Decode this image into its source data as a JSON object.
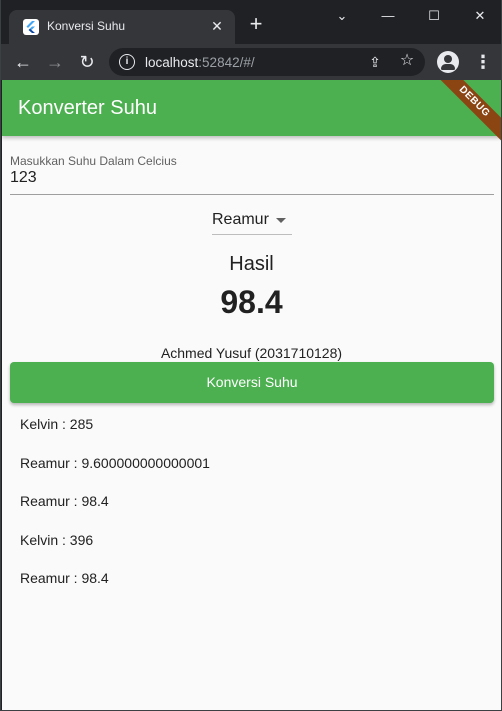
{
  "browser": {
    "tab_title": "Konversi Suhu",
    "url_host": "localhost",
    "url_rest": ":52842/#/"
  },
  "app": {
    "title": "Konverter Suhu",
    "debug_banner": "DEBUG",
    "input": {
      "label": "Masukkan Suhu Dalam Celcius",
      "value": "123"
    },
    "dropdown": {
      "selected": "Reamur"
    },
    "result": {
      "label": "Hasil",
      "value": "98.4"
    },
    "author": "Achmed Yusuf (2031710128)",
    "convert_button": "Konversi Suhu",
    "history": [
      "Kelvin : 285",
      "Reamur : 9.600000000000001",
      "Reamur : 98.4",
      "Kelvin : 396",
      "Reamur : 98.4"
    ]
  },
  "colors": {
    "primary": "#4caf50",
    "debug_banner": "#8b4513",
    "browser_frame": "#202124",
    "browser_toolbar": "#35363a"
  },
  "icons": {
    "favicon": "flutter-icon",
    "back": "arrow-left-icon",
    "forward": "arrow-right-icon",
    "reload": "reload-icon",
    "site_info": "info-icon",
    "share": "share-icon",
    "bookmark": "star-icon",
    "profile": "profile-icon",
    "menu": "kebab-menu-icon"
  }
}
